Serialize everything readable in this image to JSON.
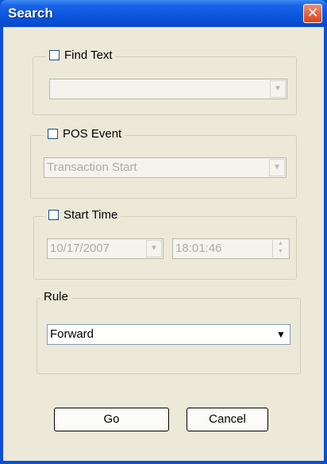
{
  "window": {
    "title": "Search",
    "close_symbol": "✕"
  },
  "find_text": {
    "label": "Find Text",
    "checked": false,
    "value": ""
  },
  "pos_event": {
    "label": "POS Event",
    "checked": false,
    "value": "Transaction Start"
  },
  "start_time": {
    "label": "Start Time",
    "checked": false,
    "date": "10/17/2007",
    "time": "18:01:46"
  },
  "rule": {
    "label": "Rule",
    "value": "Forward"
  },
  "buttons": {
    "go": "Go",
    "cancel": "Cancel"
  },
  "icons": {
    "dropdown": "chevron-down-icon",
    "close": "close-icon",
    "checkbox": "checkbox-icon",
    "spinner": "spinner-icon"
  }
}
